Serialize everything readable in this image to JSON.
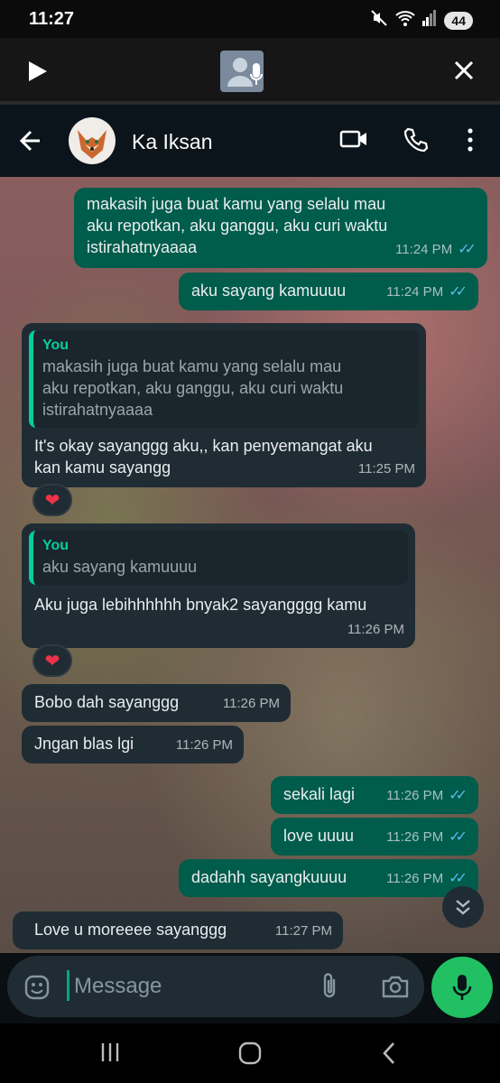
{
  "status_bar": {
    "time": "11:27",
    "battery": "44"
  },
  "voice_bar": {
    "play": "play",
    "close": "close"
  },
  "header": {
    "contact_name": "Ka Iksan"
  },
  "messages": [
    {
      "direction": "out",
      "lines": [
        "makasih juga buat kamu yang selalu mau",
        "aku repotkan, aku ganggu, aku curi waktu",
        "istirahatnyaaaa"
      ],
      "time": "11:24 PM",
      "read": true
    },
    {
      "direction": "out",
      "lines": [
        "aku sayang kamuuuu"
      ],
      "time": "11:24 PM",
      "read": true
    },
    {
      "direction": "in",
      "quote_author": "You",
      "quote_lines": [
        "makasih juga buat kamu yang selalu mau",
        "aku repotkan, aku ganggu, aku curi waktu",
        "istirahatnyaaaa"
      ],
      "lines": [
        "It's okay sayanggg aku,, kan penyemangat aku",
        "kan kamu sayangg"
      ],
      "time": "11:25 PM",
      "reaction": "❤"
    },
    {
      "direction": "in",
      "quote_author": "You",
      "quote_lines": [
        "aku sayang kamuuuu"
      ],
      "lines": [
        "Aku juga lebihhhhhh bnyak2 sayangggg kamu"
      ],
      "time": "11:26 PM",
      "reaction": "❤"
    },
    {
      "direction": "in",
      "lines": [
        "Bobo dah sayanggg"
      ],
      "time": "11:26 PM"
    },
    {
      "direction": "in",
      "lines": [
        "Jngan blas lgi"
      ],
      "time": "11:26 PM"
    },
    {
      "direction": "out",
      "lines": [
        "sekali lagi"
      ],
      "time": "11:26 PM",
      "read": true
    },
    {
      "direction": "out",
      "lines": [
        "love uuuu"
      ],
      "time": "11:26 PM",
      "read": true
    },
    {
      "direction": "out",
      "lines": [
        "dadahh sayangkuuuu"
      ],
      "time": "11:26 PM",
      "read": true
    },
    {
      "direction": "in",
      "lines": [
        "Love u moreeee sayanggg"
      ],
      "time": "11:27 PM"
    }
  ],
  "composer": {
    "placeholder": "Message"
  },
  "colors": {
    "outgoing": "#005c4b",
    "incoming": "#1f2c34",
    "accent": "#21c063",
    "read_ticks": "#53bdeb"
  },
  "icons": [
    "mute-icon",
    "wifi-icon",
    "signal-icon",
    "battery-icon",
    "play-icon",
    "contact-thumbnail-icon",
    "close-icon",
    "back-arrow-icon",
    "video-call-icon",
    "phone-icon",
    "more-vert-icon",
    "heart-icon",
    "double-chevron-down-icon",
    "emoji-icon",
    "attach-icon",
    "camera-icon",
    "mic-icon",
    "recents-icon",
    "home-icon",
    "back-icon"
  ]
}
